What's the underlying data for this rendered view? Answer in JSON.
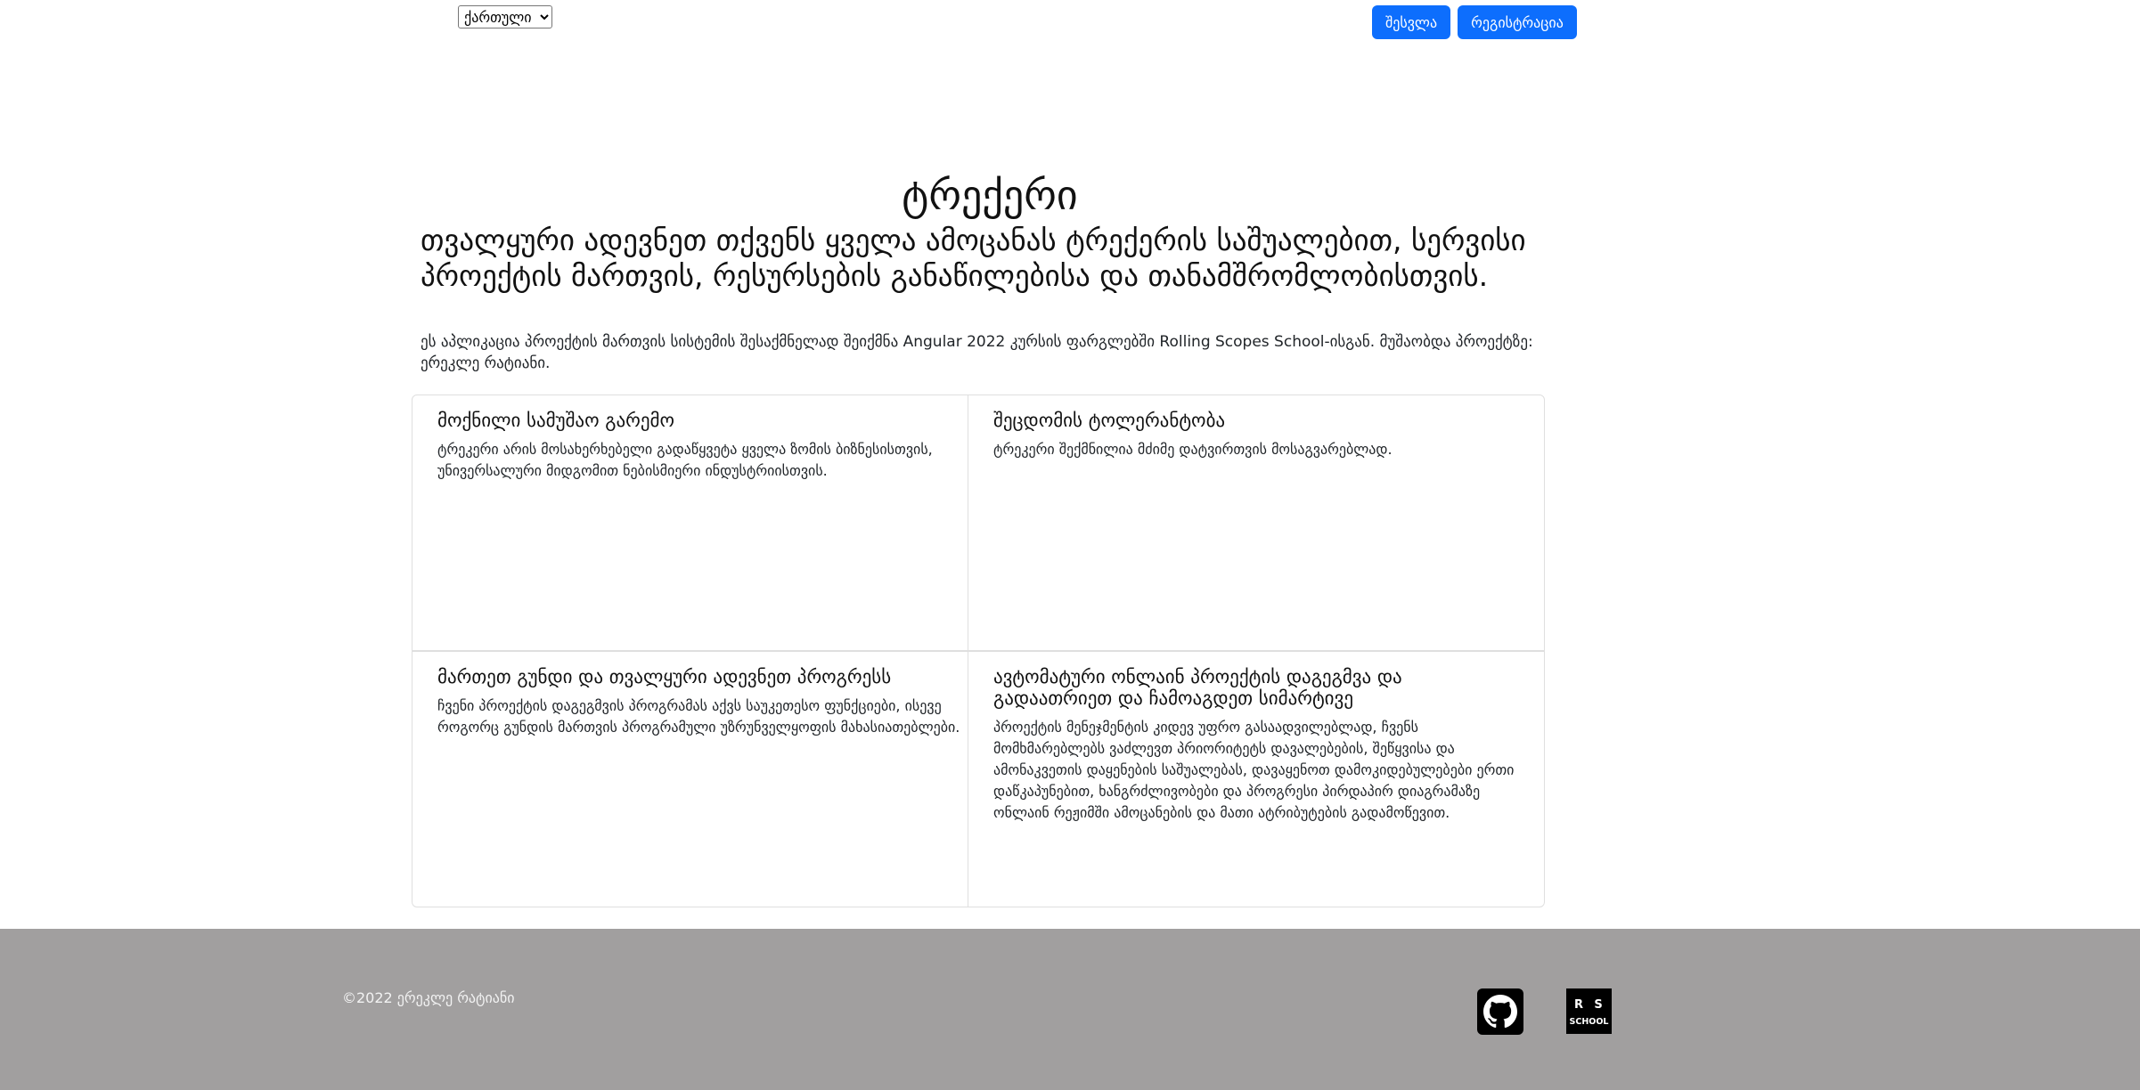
{
  "header": {
    "language_select": {
      "selected": "ქართული",
      "options": [
        "ქართული"
      ]
    },
    "login_label": "შესვლა",
    "register_label": "რეგისტრაცია"
  },
  "hero": {
    "title": "ტრექერი",
    "subtitle": "თვალყური ადევნეთ თქვენს ყველა ამოცანას ტრექერის საშუალებით, სერვისი პროექტის მართვის, რესურსების განაწილებისა და თანამშრომლობისთვის.",
    "description": "ეს აპლიკაცია პროექტის მართვის სისტემის შესაქმნელად შეიქმნა Angular 2022 კურსის ფარგლებში Rolling Scopes School-ისგან. მუშაობდა პროექტზე: ერეკლე რატიანი."
  },
  "features": [
    {
      "title": "მოქნილი სამუშაო გარემო",
      "text": "ტრეკერი არის მოსახერხებელი გადაწყვეტა ყველა ზომის ბიზნესისთვის, უნივერსალური მიდგომით ნებისმიერი ინდუსტრიისთვის."
    },
    {
      "title": "შეცდომის ტოლერანტობა",
      "text": "ტრეკერი შექმნილია მძიმე დატვირთვის მოსაგვარებლად."
    },
    {
      "title": "მართეთ გუნდი და თვალყური ადევნეთ პროგრესს",
      "text": "ჩვენი პროექტის დაგეგმვის პროგრამას აქვს საუკეთესო ფუნქციები, ისევე როგორც გუნდის მართვის პროგრამული უზრუნველყოფის მახასიათებლები."
    },
    {
      "title": "ავტომატური ონლაინ პროექტის დაგეგმვა და გადაათრიეთ და ჩამოაგდეთ სიმარტივე",
      "text": "პროექტის მენეჯმენტის კიდევ უფრო გასაადვილებლად, ჩვენს მომხმარებლებს ვაძლევთ პრიორიტეტს დავალებების, შეწყვისა და ამონაკვეთის დაყენების საშუალებას, დავაყენოთ დამოკიდებულებები ერთი დაწკაპუნებით, ხანგრძლივობები და პროგრესი პირდაპირ დიაგრამაზე ონლაინ რეჟიმში ამოცანების და მათი ატრიბუტების გადამოწევით."
    }
  ],
  "footer": {
    "copyright": "©2022 ერეკლე რატიანი",
    "github_icon": "github-icon",
    "rs_school_icon": "rs-school-logo",
    "rs_logo_text": "RS SCHOOL"
  },
  "colors": {
    "primary": "#0d6efd",
    "footer_bg": "#a19f9f",
    "card_border": "#dfdfdf"
  }
}
